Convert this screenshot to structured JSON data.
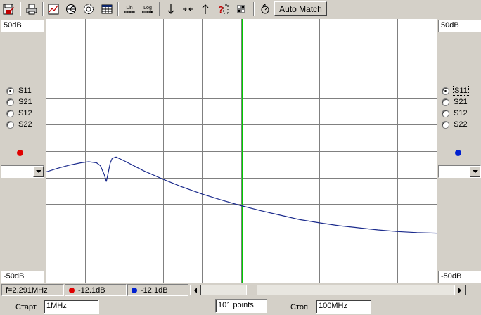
{
  "toolbar": {
    "buttons": [
      {
        "name": "save-icon"
      },
      {
        "name": "print-icon"
      },
      {
        "name": "rect-plot-icon"
      },
      {
        "name": "smith-chart-icon"
      },
      {
        "name": "polar-plot-icon"
      },
      {
        "name": "table-icon"
      },
      {
        "name": "lin-scale-icon",
        "label": "Lin"
      },
      {
        "name": "log-scale-icon",
        "label": "Log"
      },
      {
        "name": "arrow-down-icon"
      },
      {
        "name": "arrows-converge-icon"
      },
      {
        "name": "arrow-up-icon"
      },
      {
        "name": "help-icon"
      },
      {
        "name": "calibration-icon"
      },
      {
        "name": "reset-icon"
      }
    ],
    "auto_match_label": "Auto Match"
  },
  "left_panel": {
    "top_level": "50dB",
    "bottom_level": "-50dB",
    "radios": [
      {
        "label": "S11",
        "checked": true
      },
      {
        "label": "S21",
        "checked": false
      },
      {
        "label": "S12",
        "checked": false
      },
      {
        "label": "S22",
        "checked": false
      }
    ],
    "marker_color": "#e00000",
    "combo_value": ""
  },
  "right_panel": {
    "top_level": "50dB",
    "bottom_level": "-50dB",
    "radios": [
      {
        "label": "S11",
        "checked": true
      },
      {
        "label": "S21",
        "checked": false
      },
      {
        "label": "S12",
        "checked": false
      },
      {
        "label": "S22",
        "checked": false
      }
    ],
    "marker_color": "#0020d0",
    "combo_value": ""
  },
  "status": {
    "frequency": "f=2.291MHz",
    "left_marker_value": "-12.1dB",
    "right_marker_value": "-12.1dB"
  },
  "bottom": {
    "start_label": "Старт",
    "start_value": "1MHz",
    "points_value": "101 points",
    "stop_label": "Стоп",
    "stop_value": "100MHz"
  },
  "colors": {
    "trace": "#1a2a8c",
    "grid": "#808080",
    "cursor": "#00cc00"
  },
  "chart_data": {
    "type": "line",
    "ylim": [
      -50,
      50
    ],
    "grid": true,
    "grid_divisions_x": 10,
    "grid_divisions_y": 10,
    "cursor_fraction_x": 0.501,
    "series": [
      {
        "x": [
          0,
          0.03,
          0.06,
          0.09,
          0.11,
          0.13,
          0.14,
          0.15,
          0.155,
          0.16,
          0.165,
          0.17,
          0.18,
          0.2,
          0.25,
          0.3,
          0.35,
          0.4,
          0.45,
          0.5,
          0.55,
          0.6,
          0.65,
          0.7,
          0.75,
          0.8,
          0.85,
          0.9,
          0.95,
          1.0
        ],
        "values": [
          -7.9,
          -6.5,
          -5.3,
          -4.4,
          -4.0,
          -4.4,
          -5.5,
          -9.0,
          -11.5,
          -8.0,
          -4.5,
          -2.7,
          -2.2,
          -3.6,
          -7.4,
          -10.6,
          -13.6,
          -16.2,
          -18.5,
          -20.6,
          -22.5,
          -24.2,
          -25.9,
          -27.1,
          -28.2,
          -29.0,
          -29.8,
          -30.4,
          -30.8,
          -31.0
        ]
      }
    ]
  }
}
